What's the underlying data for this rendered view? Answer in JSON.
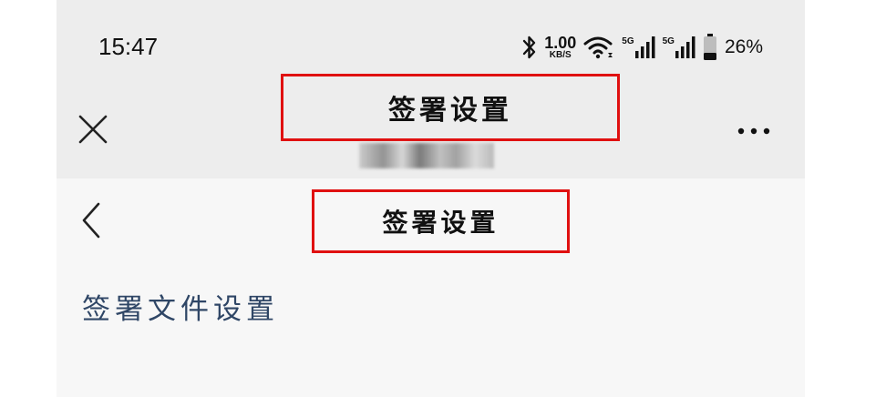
{
  "status_bar": {
    "time": "15:47",
    "net_speed_value": "1.00",
    "net_speed_unit": "KB/S",
    "signal1_label": "5G",
    "signal2_label": "5G",
    "battery_percent": "26%",
    "icons": [
      "bluetooth-icon",
      "wifi-icon",
      "signal-icon",
      "signal-icon",
      "battery-icon"
    ]
  },
  "header": {
    "title": "签署设置"
  },
  "page": {
    "title": "签署设置",
    "items": [
      {
        "label": "签署文件设置"
      }
    ]
  },
  "colors": {
    "highlight_border": "#e01010",
    "item_text": "#2f4666",
    "header_bg": "#ededed",
    "page_bg": "#f7f7f7"
  }
}
